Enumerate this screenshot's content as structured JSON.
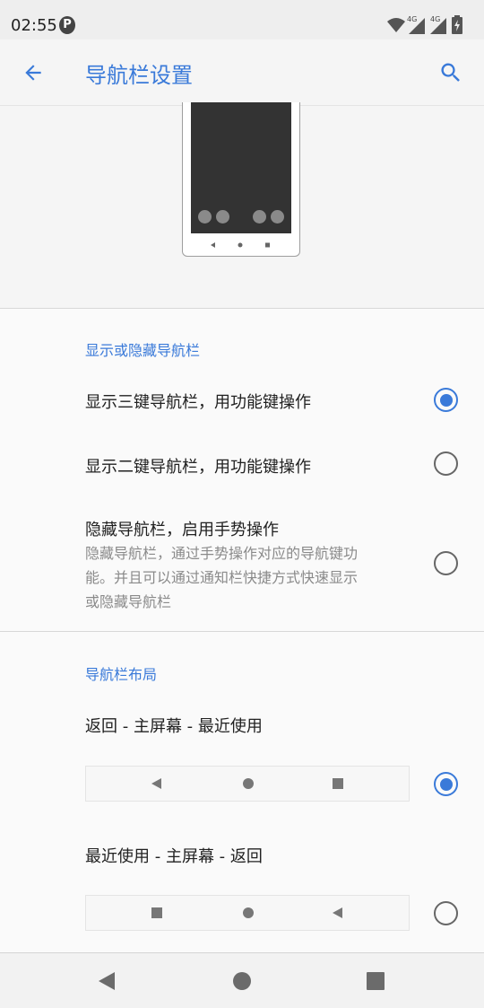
{
  "status_bar": {
    "time": "02:55",
    "notification_icon": "P",
    "signal_labels": [
      "4G",
      "4G"
    ]
  },
  "app_bar": {
    "title": "导航栏设置"
  },
  "section_show_hide": {
    "header": "显示或隐藏导航栏",
    "options": [
      {
        "title": "显示三键导航栏，用功能键操作",
        "checked": true
      },
      {
        "title": "显示二键导航栏，用功能键操作",
        "checked": false
      },
      {
        "title": "隐藏导航栏，启用手势操作",
        "summary_lines": [
          "隐藏导航栏，通过手势操作对应的导航键功",
          "能。并且可以通过通知栏快捷方式快速显示",
          "或隐藏导航栏"
        ],
        "checked": false
      }
    ]
  },
  "section_layout": {
    "header": "导航栏布局",
    "options": [
      {
        "title": "返回 - 主屏幕 - 最近使用",
        "checked": true
      },
      {
        "title": "最近使用 - 主屏幕 - 返回",
        "checked": false
      }
    ]
  },
  "colors": {
    "accent": "#3a7ad9",
    "text_primary": "#212121",
    "text_secondary": "#8a8a8a"
  }
}
